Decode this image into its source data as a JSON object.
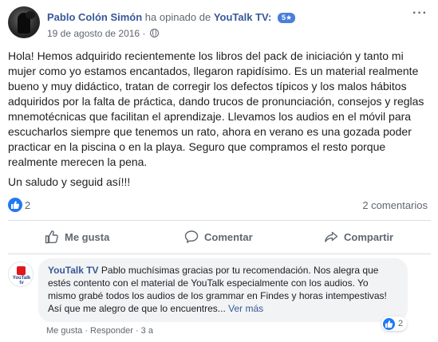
{
  "post": {
    "author_name": "Pablo Colón Simón",
    "verb_text": "ha opinado de",
    "page_name": "YouTalk TV:",
    "rating_badge": "5★",
    "date": "19 de agosto de 2016 ·",
    "more_label": "···",
    "body_paragraph_1": "Hola! Hemos adquirido recientemente los libros del pack de iniciación y tanto mi mujer como yo estamos encantados, llegaron rapidísimo. Es un material realmente bueno y muy didáctico, tratan de corregir los defectos típicos y los malos hábitos adquiridos por la falta de práctica, dando trucos de pronunciación, consejos y reglas mnemotécnicas que facilitan el aprendizaje. Llevamos los audios en el móvil para escucharlos siempre que tenemos un rato, ahora en verano es una gozada poder practicar en la piscina o en la playa. Seguro que compramos el resto porque realmente merecen la pena.",
    "body_paragraph_2": "Un saludo y seguid así!!!",
    "reaction_count": "2",
    "comment_count": "2 comentarios"
  },
  "actions": {
    "like_label": "Me gusta",
    "comment_label": "Comentar",
    "share_label": "Compartir"
  },
  "reply": {
    "avatar_logo_text": "YouTalk tv",
    "author": "YouTalk TV",
    "text": "Pablo muchísimas gracias por tu recomendación. Nos alegra que estés contento con el material de YouTalk especialmente con los audios. Yo mismo grabé todos los audios de los grammar en Findes y horas intempestivas! Así que me alegro de que lo encuentres...",
    "see_more": "Ver más",
    "reaction_count": "2",
    "like_link": "Me gusta",
    "separator": "·",
    "reply_link": "Responder",
    "age": "3 a"
  },
  "colors": {
    "link_blue": "#385898",
    "like_blue": "#2078f4",
    "secondary_text": "#606770"
  }
}
